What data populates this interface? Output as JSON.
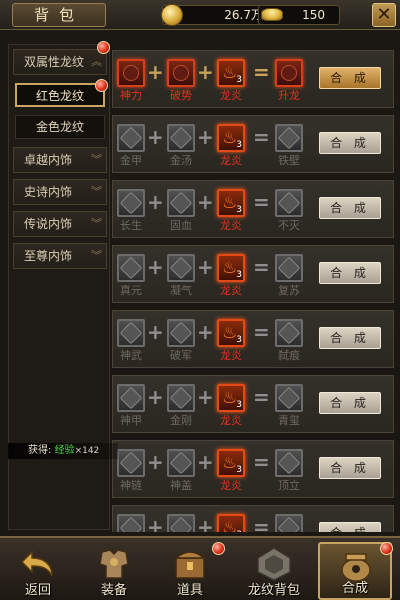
{
  "header": {
    "title": "背包",
    "gold": "26.7万",
    "ingot": "150",
    "close_label": "✕"
  },
  "sidebar": {
    "categories": [
      {
        "label": "双属性龙纹",
        "chevron": "︽"
      },
      {
        "label": "卓越内饰",
        "chevron": "︾"
      },
      {
        "label": "史诗内饰",
        "chevron": "︾"
      },
      {
        "label": "传说内饰",
        "chevron": "︾"
      },
      {
        "label": "至尊内饰",
        "chevron": "︾"
      }
    ],
    "subitems": [
      {
        "label": "红色龙纹"
      },
      {
        "label": "金色龙纹"
      }
    ]
  },
  "gain": {
    "label": "获得:",
    "exp": "经验",
    "count": "×142"
  },
  "recipes": [
    {
      "a": "神力",
      "b": "破势",
      "c": "龙炎",
      "result": "升龙",
      "button": "合 成",
      "active": true
    },
    {
      "a": "金甲",
      "b": "金汤",
      "c": "龙炎",
      "result": "铁壁",
      "button": "合 成",
      "active": false
    },
    {
      "a": "长生",
      "b": "固血",
      "c": "龙炎",
      "result": "不灭",
      "button": "合 成",
      "active": false
    },
    {
      "a": "真元",
      "b": "凝气",
      "c": "龙炎",
      "result": "复苏",
      "button": "合 成",
      "active": false
    },
    {
      "a": "神武",
      "b": "破军",
      "c": "龙炎",
      "result": "弑痕",
      "button": "合 成",
      "active": false
    },
    {
      "a": "神甲",
      "b": "金刚",
      "c": "龙炎",
      "result": "青玺",
      "button": "合 成",
      "active": false
    },
    {
      "a": "神链",
      "b": "神盖",
      "c": "龙炎",
      "result": "顶立",
      "button": "合 成",
      "active": false
    },
    {
      "a": "",
      "b": "",
      "c": "",
      "result": "",
      "button": "合 成",
      "active": false
    }
  ],
  "fire_count": "3",
  "plus": "+",
  "equals": "=",
  "bottom_nav": [
    {
      "label": "返回",
      "icon": "back-arrow-icon"
    },
    {
      "label": "装备",
      "icon": "armor-icon"
    },
    {
      "label": "道具",
      "icon": "chest-icon"
    },
    {
      "label": "龙纹背包",
      "icon": "dragon-bag-icon"
    },
    {
      "label": "合成",
      "icon": "cauldron-icon"
    }
  ]
}
